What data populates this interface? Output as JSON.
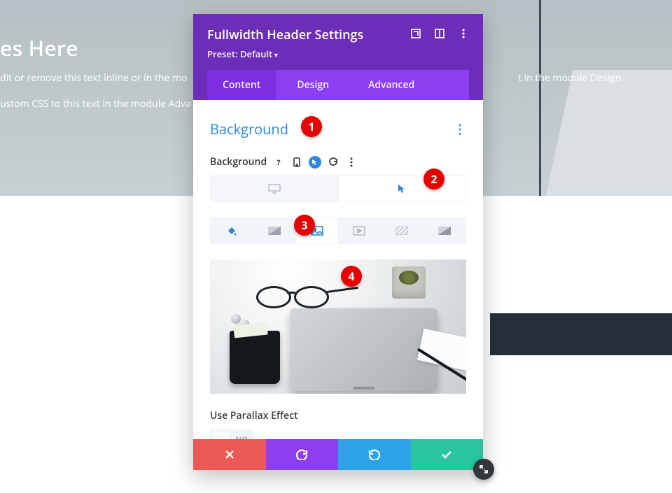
{
  "hero": {
    "title_fragment": "es Here",
    "line1": "dit or remove this text inline or in the mo",
    "line2": "ustom CSS to this text in the module Adva",
    "right_fragment": "t in the module Design"
  },
  "modal": {
    "title": "Fullwidth Header Settings",
    "preset_label": "Preset: Default",
    "header_icons": {
      "expand": "expand-icon",
      "panel": "panel-toggle-icon",
      "kebab": "kebab-icon"
    },
    "tabs": [
      {
        "label": "Content",
        "active": true
      },
      {
        "label": "Design",
        "active": false
      },
      {
        "label": "Advanced",
        "active": false
      }
    ],
    "section": {
      "title": "Background",
      "menu_icon": "kebab-icon"
    },
    "field": {
      "label": "Background",
      "icons": [
        "help-icon",
        "phone-icon",
        "hover-icon",
        "reset-icon",
        "kebab-icon"
      ]
    },
    "device_targets": {
      "desktop": "desktop-icon",
      "hover": "cursor-icon"
    },
    "bg_type_tabs": [
      {
        "name": "color",
        "icon": "paint-icon",
        "active": false,
        "colored": true
      },
      {
        "name": "gradient",
        "icon": "gradient-icon",
        "active": false,
        "colored": false
      },
      {
        "name": "image",
        "icon": "image-icon",
        "active": true,
        "colored": true
      },
      {
        "name": "video",
        "icon": "video-icon",
        "active": false,
        "colored": false
      },
      {
        "name": "pattern",
        "icon": "pattern-icon",
        "active": false,
        "colored": false
      },
      {
        "name": "mask",
        "icon": "mask-icon",
        "active": false,
        "colored": false
      }
    ],
    "parallax": {
      "label": "Use Parallax Effect",
      "value_label": "NO",
      "value": false
    },
    "actions": {
      "cancel": "cancel",
      "undo": "undo",
      "redo": "redo",
      "save": "save"
    }
  },
  "annotations": [
    "1",
    "2",
    "3",
    "4"
  ],
  "colors": {
    "purple_dark": "#6c2eb9",
    "purple": "#8b3ff0",
    "blue": "#2b87da",
    "red": "#eb5a55",
    "cyan": "#2ea3e8",
    "green": "#29c4a0",
    "badge": "#e60000"
  }
}
